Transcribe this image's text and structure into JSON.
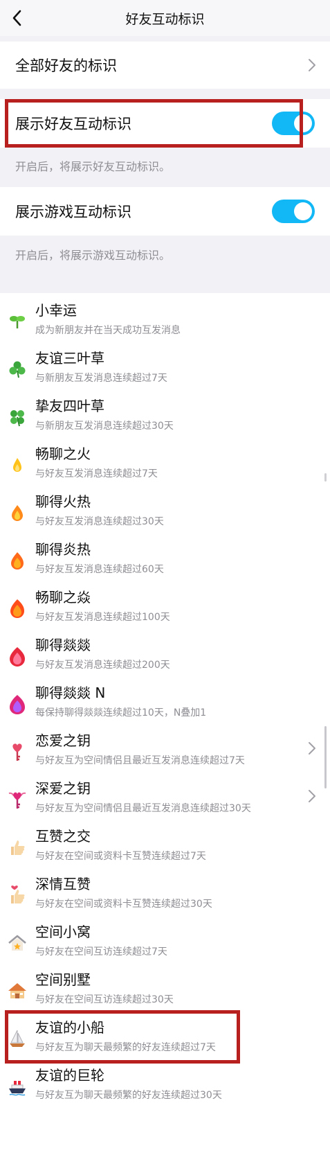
{
  "header": {
    "title": "好友互动标识"
  },
  "all_friends": {
    "label": "全部好友的标识"
  },
  "friend_toggle": {
    "label": "展示好友互动标识",
    "on": true,
    "hint": "开启后，将展示好友互动标识。"
  },
  "game_toggle": {
    "label": "展示游戏互动标识",
    "on": true,
    "hint": "开启后，将展示游戏互动标识。"
  },
  "colors": {
    "accent": "#12b7f5",
    "highlight": "#b8201f",
    "muted": "#8d8d93"
  },
  "badges": [
    {
      "icon": "sprout-icon",
      "title": "小幸运",
      "desc": "成为新朋友并在当天成功互发消息"
    },
    {
      "icon": "three-leaf-clover-icon",
      "title": "友谊三叶草",
      "desc": "与新朋友互发消息连续超过7天"
    },
    {
      "icon": "four-leaf-clover-icon",
      "title": "挚友四叶草",
      "desc": "与新朋友互发消息连续超过30天"
    },
    {
      "icon": "small-flame-icon",
      "title": "畅聊之火",
      "desc": "与好友互发消息连续超过7天"
    },
    {
      "icon": "flame-icon",
      "title": "聊得火热",
      "desc": "与好友互发消息连续超过30天"
    },
    {
      "icon": "flame-icon",
      "title": "聊得炎热",
      "desc": "与好友互发消息连续超过60天"
    },
    {
      "icon": "big-flame-icon",
      "title": "畅聊之焱",
      "desc": "与好友互发消息连续超过100天"
    },
    {
      "icon": "red-flame-icon",
      "title": "聊得燚燚",
      "desc": "与好友互发消息连续超过200天"
    },
    {
      "icon": "purple-flame-icon",
      "title": "聊得燚燚 N",
      "desc": "每保持聊得燚燚连续超过10天，N叠加1"
    },
    {
      "icon": "heart-key-icon",
      "title": "恋爱之钥",
      "desc": "与好友互为空间情侣且最近互发消息连续超过7天",
      "has_arrow": true
    },
    {
      "icon": "winged-heart-key-icon",
      "title": "深爱之钥",
      "desc": "与好友互为空间情侣且最近互发消息连续超过30天",
      "has_arrow": true
    },
    {
      "icon": "thumbs-up-icon",
      "title": "互赞之交",
      "desc": "与好友在空间或资料卡互赞连续超过7天"
    },
    {
      "icon": "heart-thumbs-up-icon",
      "title": "深情互赞",
      "desc": "与好友在空间或资料卡互赞连续超过30天"
    },
    {
      "icon": "small-house-icon",
      "title": "空间小窝",
      "desc": "与好友在空间互访连续超过7天"
    },
    {
      "icon": "villa-icon",
      "title": "空间别墅",
      "desc": "与好友在空间互访连续超过30天"
    },
    {
      "icon": "sailboat-icon",
      "title": "友谊的小船",
      "desc": "与好友互为聊天最频繁的好友连续超过7天"
    },
    {
      "icon": "ship-icon",
      "title": "友谊的巨轮",
      "desc": "与好友互为聊天最频繁的好友连续超过30天"
    }
  ]
}
